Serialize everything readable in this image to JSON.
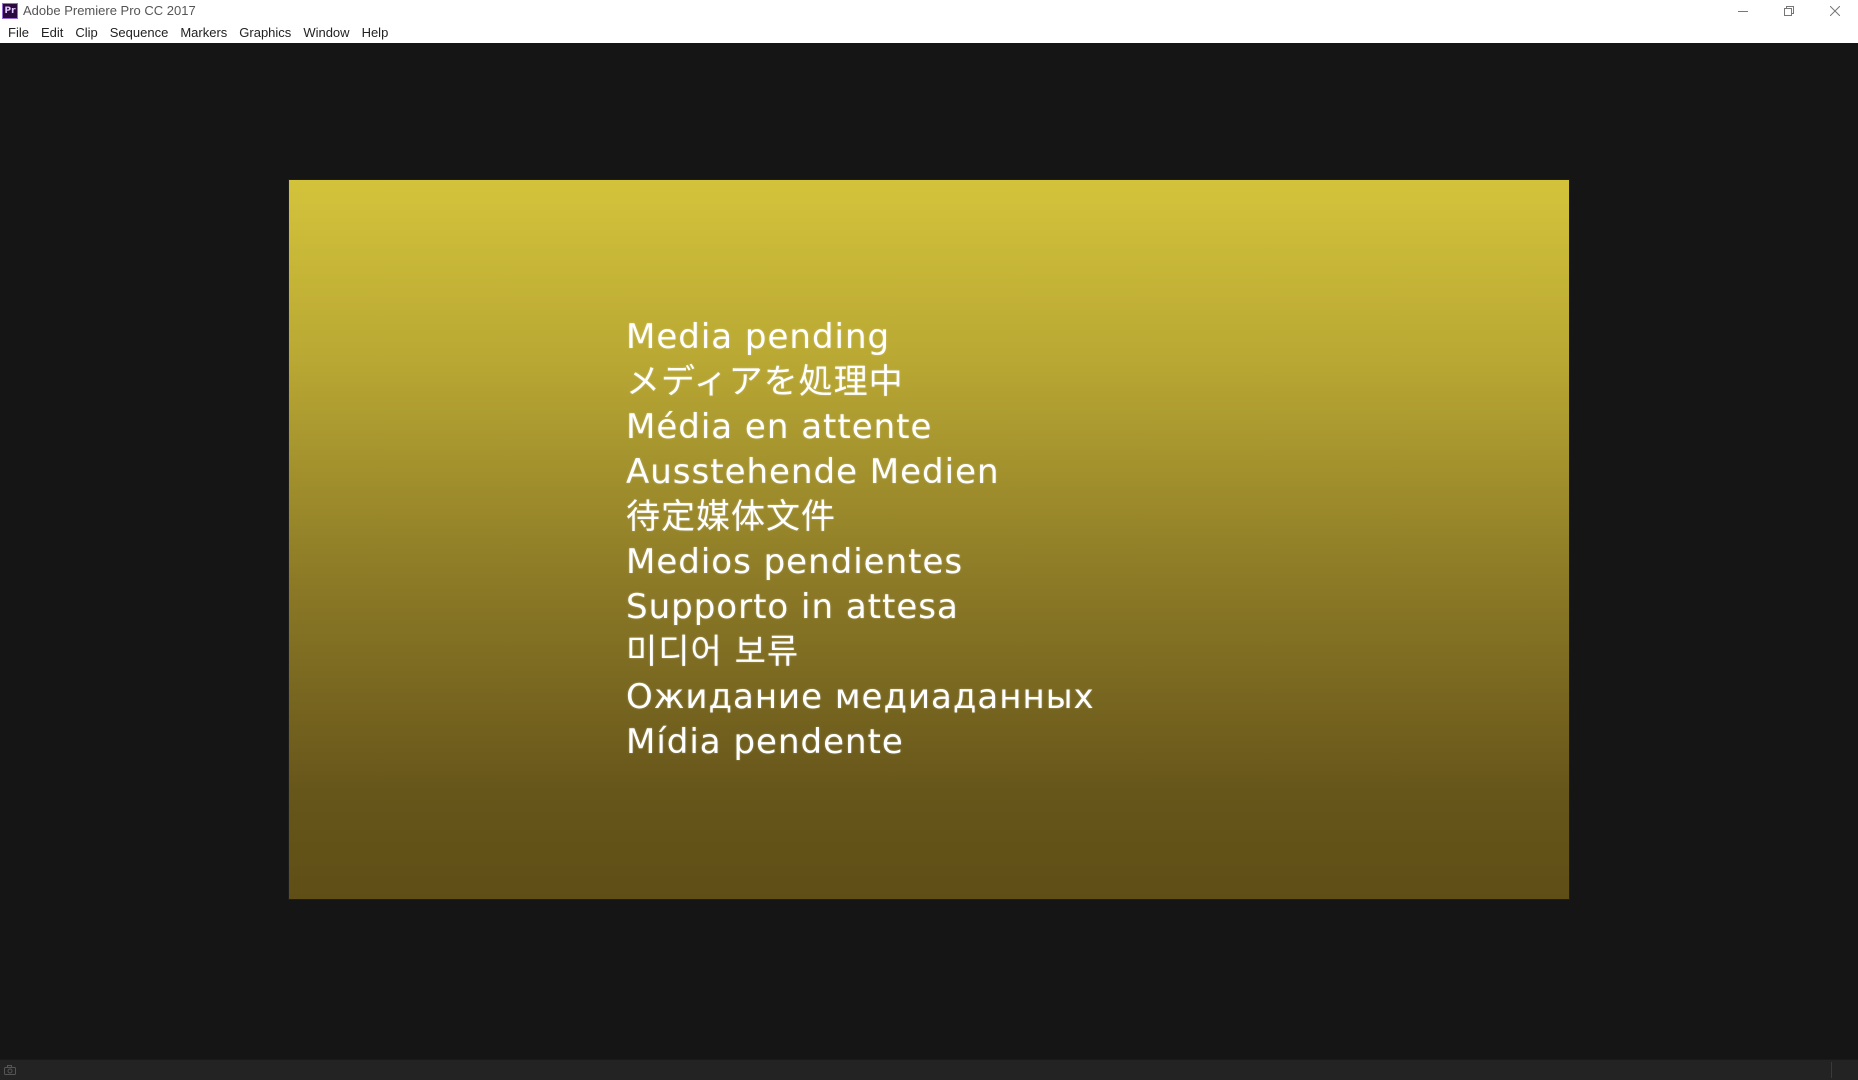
{
  "window": {
    "app_icon_text": "Pr",
    "title": "Adobe Premiere Pro CC 2017",
    "controls": {
      "minimize_icon": "minimize-icon",
      "restore_icon": "restore-icon",
      "close_icon": "close-icon"
    }
  },
  "menu": {
    "items": [
      {
        "label": "File"
      },
      {
        "label": "Edit"
      },
      {
        "label": "Clip"
      },
      {
        "label": "Sequence"
      },
      {
        "label": "Markers"
      },
      {
        "label": "Graphics"
      },
      {
        "label": "Window"
      },
      {
        "label": "Help"
      }
    ]
  },
  "monitor": {
    "pending_messages": [
      "Media pending",
      "メディアを処理中",
      "Média en attente",
      "Ausstehende Medien",
      "待定媒体文件",
      "Medios pendientes",
      "Supporto in attesa",
      "미디어 보류",
      "Ожидание медиаданных",
      "Mídia pendente"
    ]
  },
  "statusbar": {
    "icon": "render-status-icon"
  },
  "colors": {
    "workspace_bg": "#151515",
    "frame_top": "#d3c33b",
    "frame_bottom": "#5f4f17",
    "message_text": "#ffffff"
  }
}
